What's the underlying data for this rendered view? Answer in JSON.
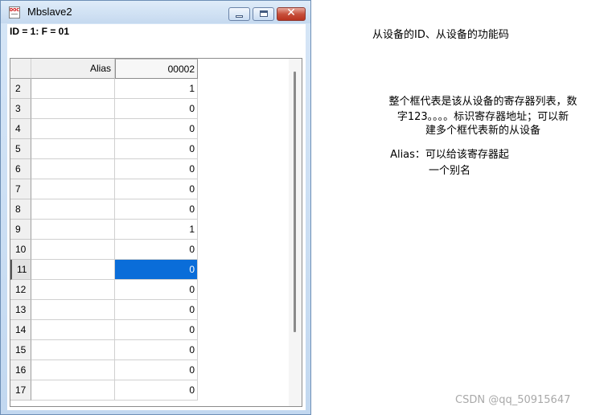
{
  "window": {
    "title": "Mbslave2",
    "header_line": "ID = 1: F = 01"
  },
  "grid": {
    "columns": [
      "Alias",
      "00002"
    ],
    "rows": [
      {
        "num": "2",
        "alias": "",
        "value": "1"
      },
      {
        "num": "3",
        "alias": "",
        "value": "0"
      },
      {
        "num": "4",
        "alias": "",
        "value": "0"
      },
      {
        "num": "5",
        "alias": "",
        "value": "0"
      },
      {
        "num": "6",
        "alias": "",
        "value": "0"
      },
      {
        "num": "7",
        "alias": "",
        "value": "0"
      },
      {
        "num": "8",
        "alias": "",
        "value": "0"
      },
      {
        "num": "9",
        "alias": "",
        "value": "1"
      },
      {
        "num": "10",
        "alias": "",
        "value": "0"
      },
      {
        "num": "11",
        "alias": "",
        "value": "0",
        "selected": true
      },
      {
        "num": "12",
        "alias": "",
        "value": "0"
      },
      {
        "num": "13",
        "alias": "",
        "value": "0"
      },
      {
        "num": "14",
        "alias": "",
        "value": "0"
      },
      {
        "num": "15",
        "alias": "",
        "value": "0"
      },
      {
        "num": "16",
        "alias": "",
        "value": "0"
      },
      {
        "num": "17",
        "alias": "",
        "value": "0"
      }
    ]
  },
  "annotations": {
    "id_note": "从设备的ID、从设备的功能码",
    "table_note_line1": "整个框代表是该从设备的寄存器列表，数",
    "table_note_line2": "字123。。。。标识寄存器地址；可以新",
    "table_note_line3": "建多个框代表新的从设备",
    "alias_note_line1": "Alias：可以给该寄存器起",
    "alias_note_line2": "一个别名"
  },
  "watermark": "CSDN @qq_50915647",
  "colors": {
    "selection": "#0a6dd9",
    "title_bar": "#c5d9ef",
    "close_button": "#c7503c"
  },
  "icons": [
    "document-app-icon",
    "minimize-icon",
    "maximize-icon",
    "close-icon"
  ]
}
